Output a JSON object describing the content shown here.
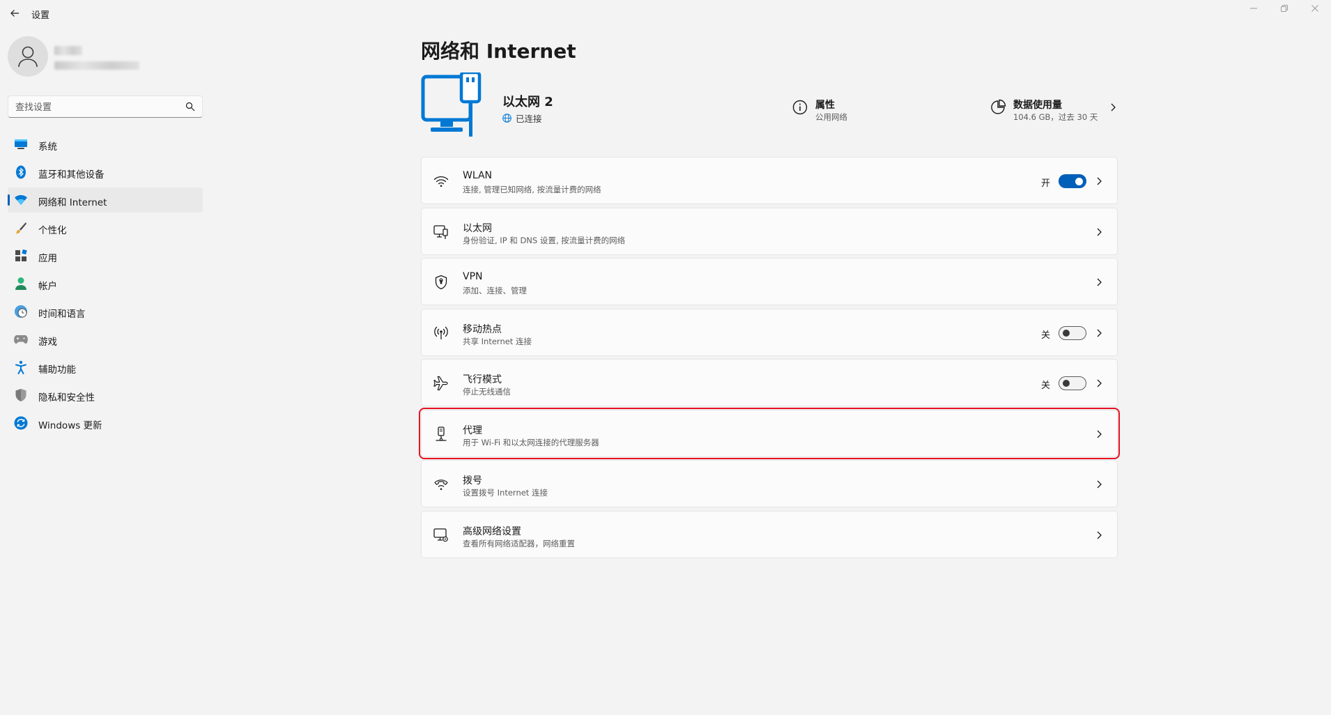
{
  "window": {
    "title": "设置",
    "controls": [
      "minimize-icon",
      "restore-icon",
      "close-icon"
    ]
  },
  "search": {
    "placeholder": "查找设置",
    "value": ""
  },
  "sidebar": {
    "items": [
      {
        "label": "系统",
        "icon": "system-icon"
      },
      {
        "label": "蓝牙和其他设备",
        "icon": "bluetooth-icon"
      },
      {
        "label": "网络和 Internet",
        "icon": "wifi-icon",
        "active": true
      },
      {
        "label": "个性化",
        "icon": "brush-icon"
      },
      {
        "label": "应用",
        "icon": "apps-icon"
      },
      {
        "label": "帐户",
        "icon": "account-icon"
      },
      {
        "label": "时间和语言",
        "icon": "clock-globe-icon"
      },
      {
        "label": "游戏",
        "icon": "gamepad-icon"
      },
      {
        "label": "辅助功能",
        "icon": "accessibility-icon"
      },
      {
        "label": "隐私和安全性",
        "icon": "shield-icon"
      },
      {
        "label": "Windows 更新",
        "icon": "update-icon"
      }
    ]
  },
  "main": {
    "title": "网络和 Internet",
    "connection": {
      "name": "以太网 2",
      "status": "已连接"
    },
    "properties": {
      "title": "属性",
      "subtitle": "公用网络"
    },
    "data_usage": {
      "title": "数据使用量",
      "subtitle": "104.6 GB，过去 30 天"
    },
    "cards": [
      {
        "title": "WLAN",
        "subtitle": "连接, 管理已知网络, 按流量计费的网络",
        "icon": "wifi-icon",
        "toggle_label": "开",
        "toggle_on": true
      },
      {
        "title": "以太网",
        "subtitle": "身份验证, IP 和 DNS 设置, 按流量计费的网络",
        "icon": "ethernet-icon"
      },
      {
        "title": "VPN",
        "subtitle": "添加、连接、管理",
        "icon": "vpn-shield-icon"
      },
      {
        "title": "移动热点",
        "subtitle": "共享 Internet 连接",
        "icon": "hotspot-icon",
        "toggle_label": "关",
        "toggle_on": false
      },
      {
        "title": "飞行模式",
        "subtitle": "停止无线通信",
        "icon": "airplane-icon",
        "toggle_label": "关",
        "toggle_on": false
      },
      {
        "title": "代理",
        "subtitle": "用于 Wi-Fi 和以太网连接的代理服务器",
        "icon": "proxy-icon",
        "highlighted": true
      },
      {
        "title": "拨号",
        "subtitle": "设置拨号 Internet 连接",
        "icon": "dialup-icon"
      },
      {
        "title": "高级网络设置",
        "subtitle": "查看所有网络适配器，网络重置",
        "icon": "advanced-network-icon"
      }
    ]
  },
  "colors": {
    "accent": "#005fb8",
    "highlight_border": "#e81123",
    "background": "#f3f3f3",
    "card": "#fbfbfb"
  }
}
